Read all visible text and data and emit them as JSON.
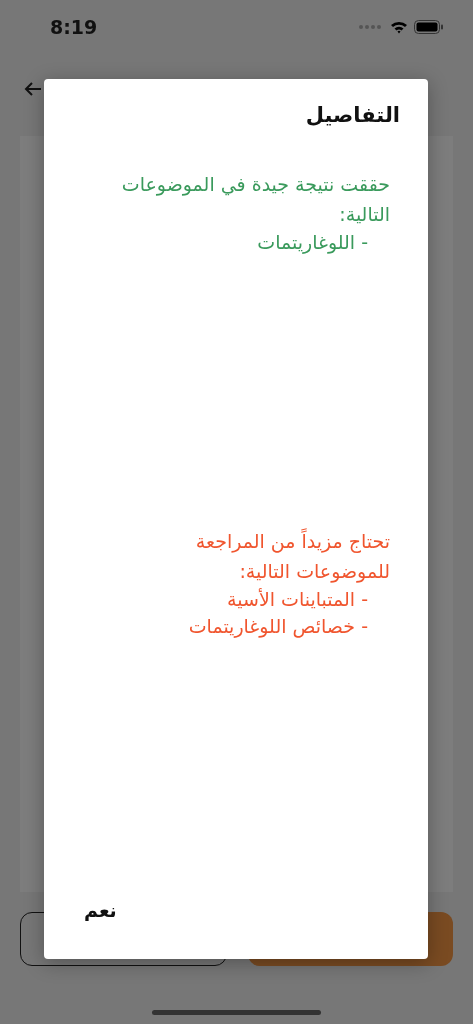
{
  "status_bar": {
    "time": "8:19"
  },
  "dialog": {
    "title": "التفاصيل",
    "sections": [
      {
        "color": "#3a9a5c",
        "text": "حققت نتيجة جيدة في الموضوعات التالية:",
        "items": [
          "- اللوغاريتمات"
        ]
      },
      {
        "color": "#f0552e",
        "text": "تحتاج مزيداً من المراجعة للموضوعات التالية:",
        "items": [
          "- المتباينات الأسية",
          "- خصائص اللوغاريتمات"
        ]
      }
    ],
    "button": "نعم"
  }
}
